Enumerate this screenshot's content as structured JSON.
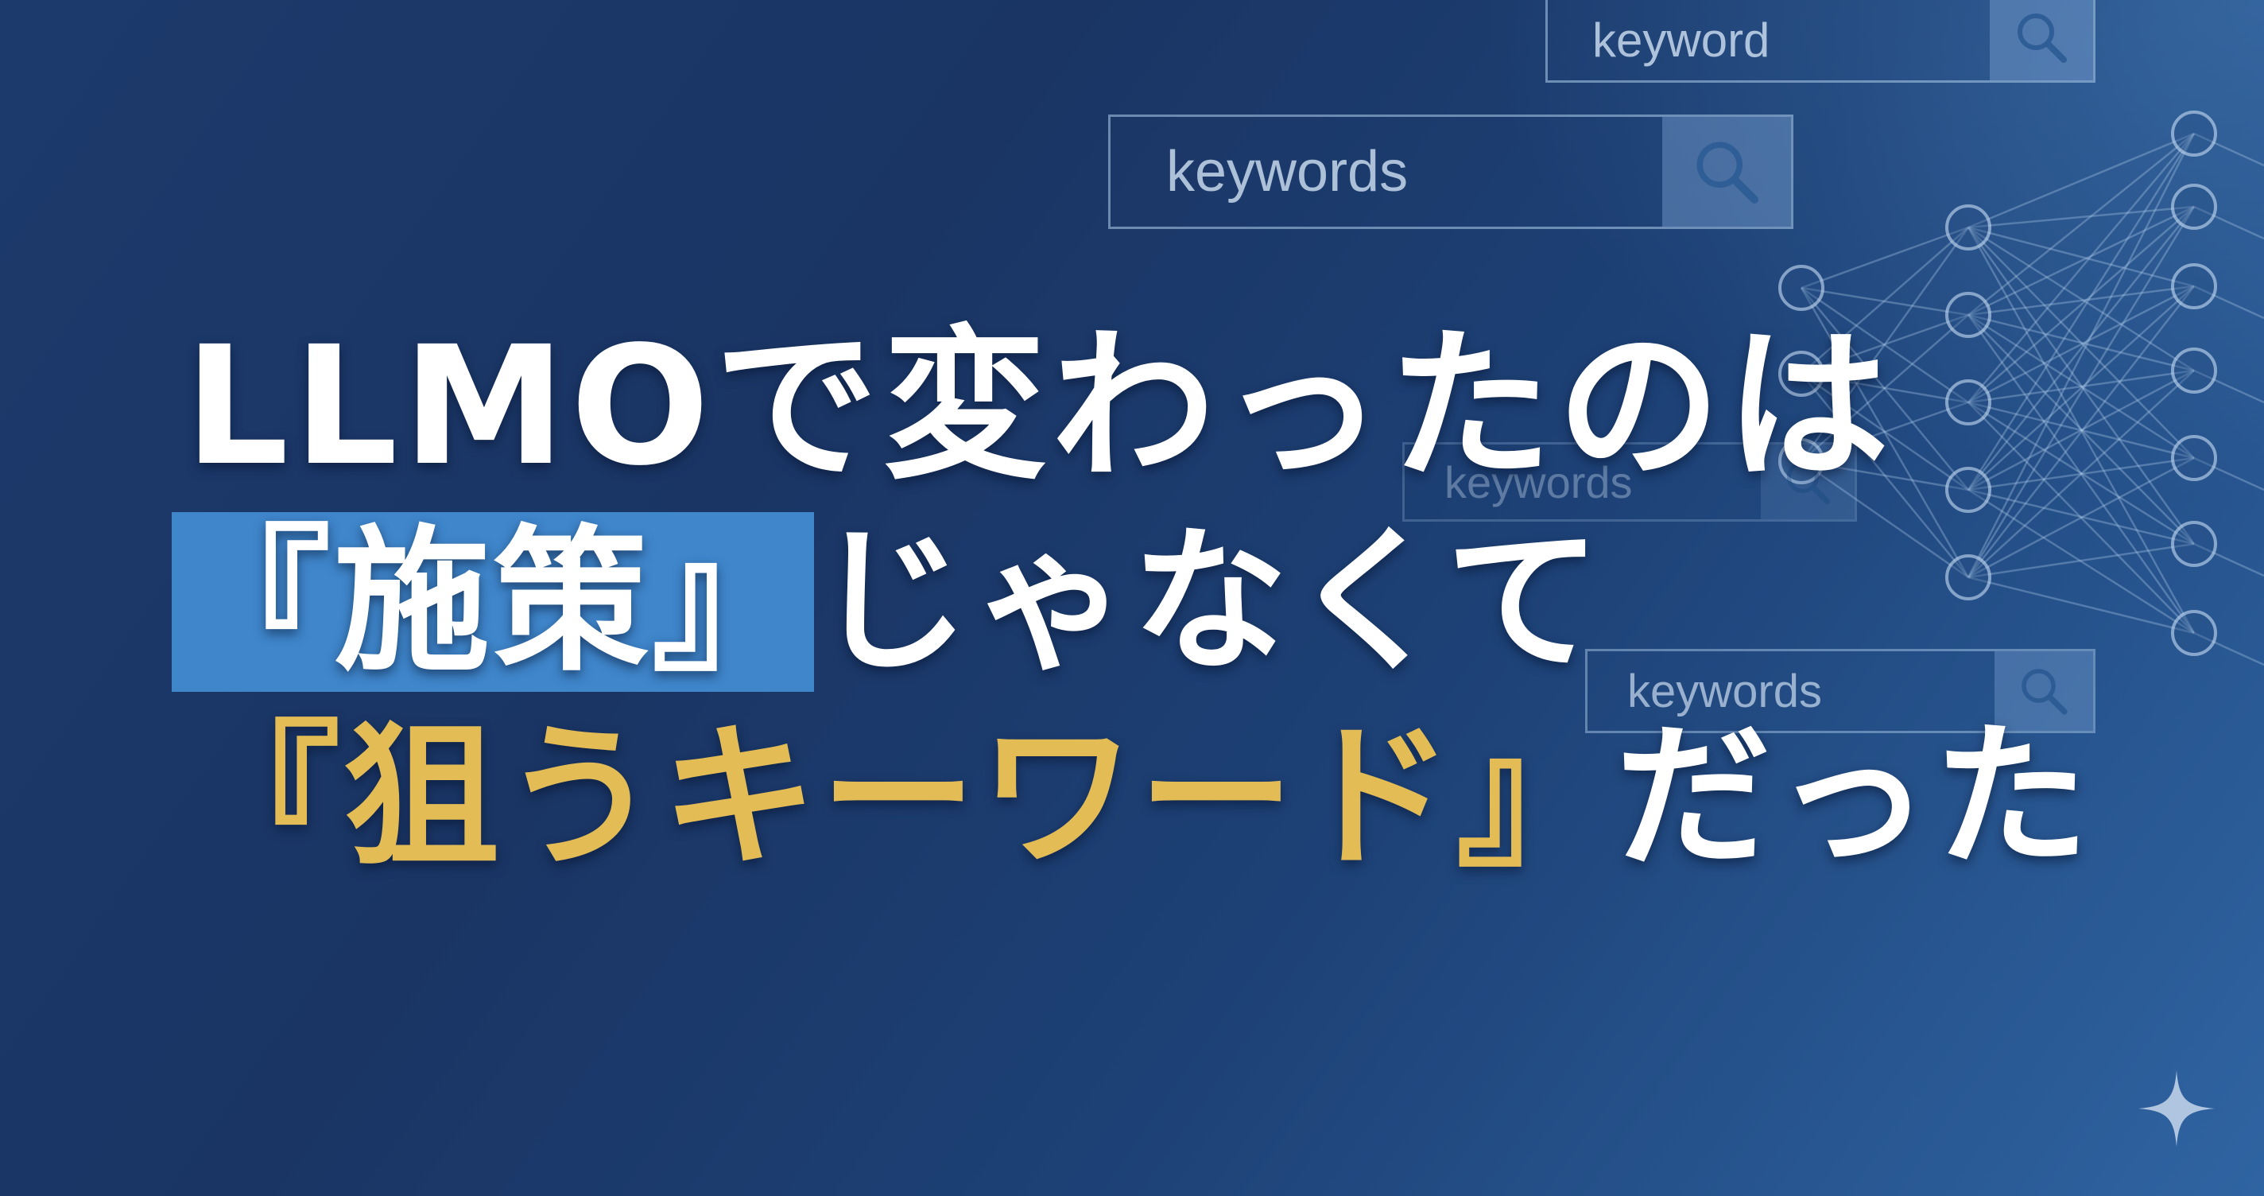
{
  "search_boxes": [
    {
      "text": "keyword"
    },
    {
      "text": "keywords"
    },
    {
      "text": "keywords"
    },
    {
      "text": "keywords"
    }
  ],
  "headline": {
    "line1": "LLMOで変わったのは",
    "line2_highlight": "『施策』",
    "line2_rest": "じゃなくて",
    "line3_highlight": "『狙うキーワード』",
    "line3_rest": "だった"
  },
  "colors": {
    "background_dark": "#1a3564",
    "background_light": "#2f64a2",
    "highlight_box": "#3f86cb",
    "highlight_text": "#e3bc55",
    "text": "#ffffff"
  },
  "icons": [
    "search-icon",
    "neural-network-graphic",
    "sparkle-icon"
  ]
}
